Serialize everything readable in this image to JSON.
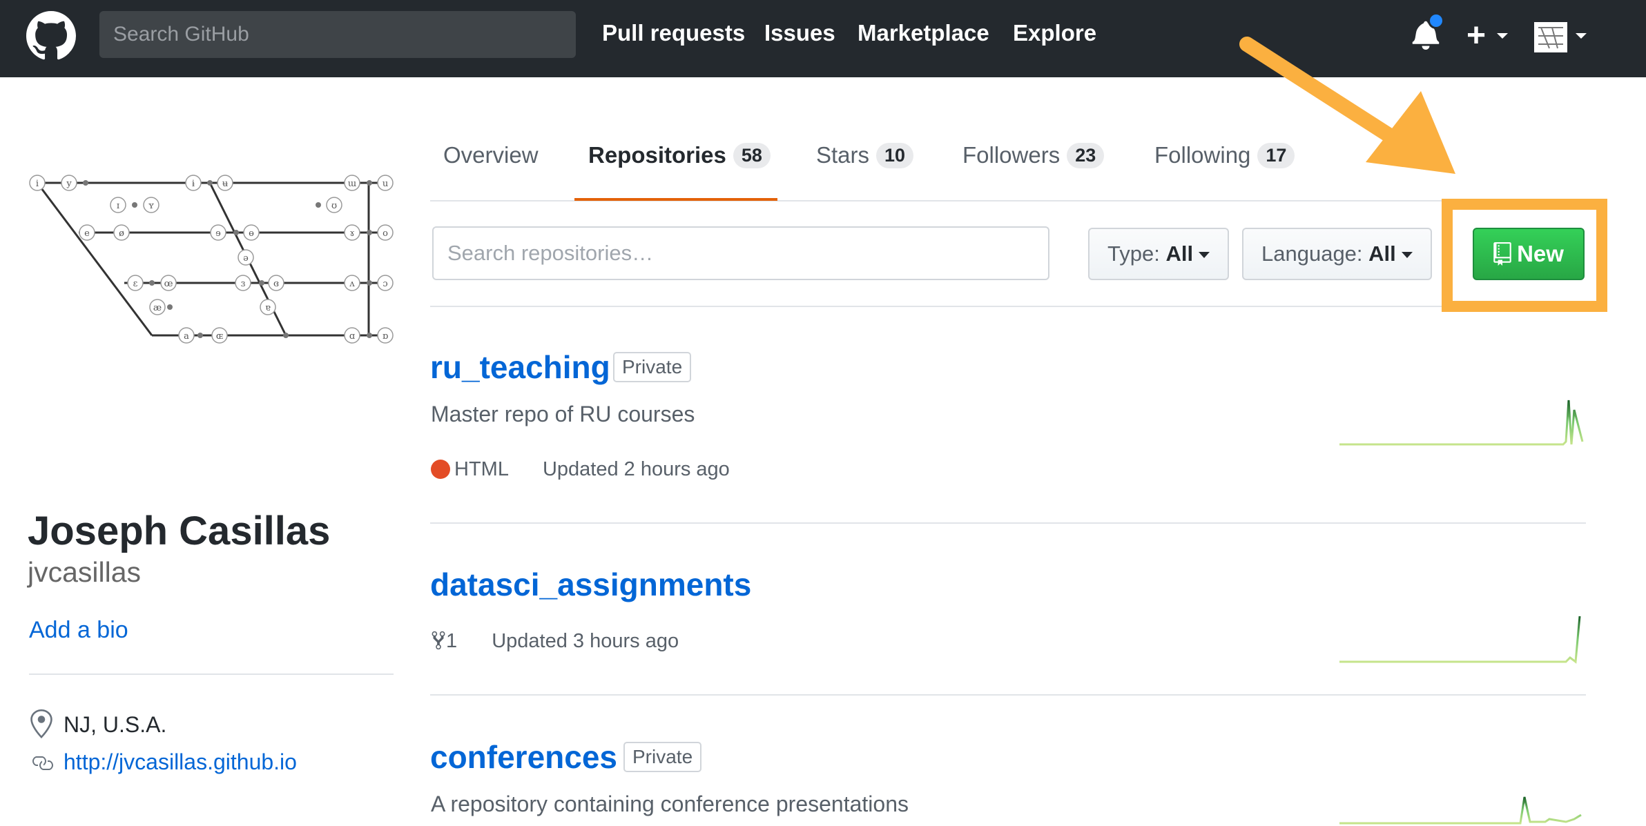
{
  "header": {
    "search_placeholder": "Search GitHub",
    "nav": [
      "Pull requests",
      "Issues",
      "Marketplace",
      "Explore"
    ],
    "icons": [
      "github-logo-icon",
      "bell-icon",
      "plus-icon",
      "avatar"
    ]
  },
  "profile": {
    "full_name": "Joseph Casillas",
    "username": "jvcasillas",
    "add_bio": "Add a bio",
    "location": "NJ, U.S.A.",
    "website": "http://jvcasillas.github.io"
  },
  "tabs": [
    {
      "label": "Overview",
      "count": ""
    },
    {
      "label": "Repositories",
      "count": "58"
    },
    {
      "label": "Stars",
      "count": "10"
    },
    {
      "label": "Followers",
      "count": "23"
    },
    {
      "label": "Following",
      "count": "17"
    }
  ],
  "active_tab": "Repositories",
  "filters": {
    "search_placeholder": "Search repositories…",
    "type_label": "Type:",
    "type_value": "All",
    "language_label": "Language:",
    "language_value": "All",
    "new_label": "New"
  },
  "repos": [
    {
      "name": "ru_teaching",
      "badge": "Private",
      "description": "Master repo of RU courses",
      "language": "HTML",
      "language_color": "#e34c26",
      "updated": "Updated 2 hours ago"
    },
    {
      "name": "datasci_assignments",
      "forks": "1",
      "updated": "Updated 3 hours ago"
    },
    {
      "name": "conferences",
      "badge": "Private",
      "description": "A repository containing conference presentations"
    }
  ],
  "colors": {
    "header_bg": "#24292e",
    "link": "#0366d6",
    "new_button": "#28a745",
    "annotation": "#fbb040",
    "active_tab_underline": "#e36209"
  }
}
